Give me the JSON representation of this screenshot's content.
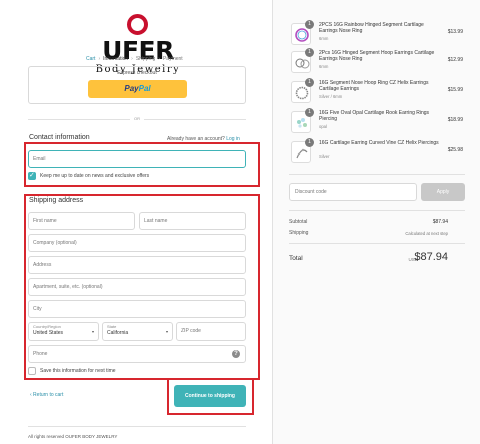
{
  "brand": {
    "logo_text": "UFER",
    "tagline": "Body Jewelry"
  },
  "breadcrumb": {
    "cart": "Cart",
    "information": "Information",
    "shipping": "Shipping",
    "payment": "Payment"
  },
  "express": {
    "title": "Express checkout",
    "paypal_pay": "Pay",
    "paypal_pal": "Pal"
  },
  "divider_or": "OR",
  "contact": {
    "title": "Contact information",
    "have_account": "Already have an account?",
    "login": "Log in",
    "email_placeholder": "Email",
    "news_label": "Keep me up to date on news and exclusive offers",
    "news_checked": true
  },
  "shipping": {
    "title": "Shipping address",
    "first_name": "First name",
    "last_name": "Last name",
    "company": "Company (optional)",
    "address": "Address",
    "apartment": "Apartment, suite, etc. (optional)",
    "city": "City",
    "country_label": "Country/Region",
    "country_value": "United States",
    "state_label": "State",
    "state_value": "California",
    "zip": "ZIP code",
    "phone": "Phone",
    "save_label": "Save this information for next time",
    "save_checked": false
  },
  "actions": {
    "return_label": "‹ Return to cart",
    "continue_label": "Continue to shipping"
  },
  "footer": "All rights reserved OUFER BODY JEWELRY",
  "order": {
    "items": [
      {
        "qty": "1",
        "name": "2PCS 16G Rainbow Hinged Segment Cartilage Earrings Nose Ring",
        "variant": "6mm",
        "price": "$13.99"
      },
      {
        "qty": "1",
        "name": "2Pcs 16G Hinged Segment Hoop Earrings Cartilage Earrings Nose Ring",
        "variant": "6mm",
        "price": "$12.99"
      },
      {
        "qty": "1",
        "name": "16G Segment Nose Hoop Ring CZ Helix Earrings Cartilage Earrings",
        "variant": "Silver / 6mm",
        "price": "$15.99"
      },
      {
        "qty": "1",
        "name": "16G Five Oval Opal Cartilage Rook Earring Rings Piercing",
        "variant": "opal",
        "price": "$18.99"
      },
      {
        "qty": "1",
        "name": "16G Cartilage Earring Curved Vine CZ Helix Piercings",
        "variant": "Silver",
        "price": "$25.98"
      }
    ],
    "discount_placeholder": "Discount code",
    "apply_label": "Apply",
    "subtotal_label": "Subtotal",
    "subtotal_value": "$87.94",
    "shipping_label": "Shipping",
    "shipping_value": "Calculated at next step",
    "total_label": "Total",
    "total_currency": "USD",
    "total_value": "$87.94"
  },
  "colors": {
    "accent": "#3fb3b7",
    "brand_red": "#c8102e",
    "highlight_red": "#d7262e",
    "paypal_yellow": "#fec23c"
  }
}
